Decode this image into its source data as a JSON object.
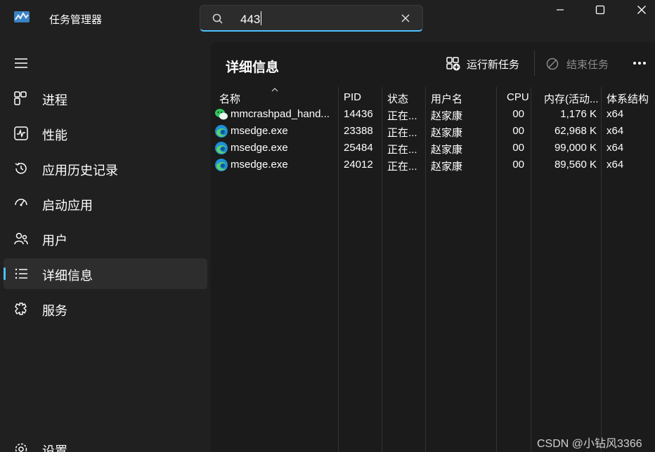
{
  "window": {
    "title": "任务管理器",
    "controls": {
      "minimize": "minimize",
      "maximize": "maximize",
      "close": "close"
    }
  },
  "search": {
    "value": "443",
    "icon": "search-icon",
    "clear_icon": "close-icon"
  },
  "sidebar": {
    "items": [
      {
        "label": "进程",
        "icon": "processes-icon"
      },
      {
        "label": "性能",
        "icon": "performance-icon"
      },
      {
        "label": "应用历史记录",
        "icon": "history-icon"
      },
      {
        "label": "启动应用",
        "icon": "startup-icon"
      },
      {
        "label": "用户",
        "icon": "users-icon"
      },
      {
        "label": "详细信息",
        "icon": "details-icon",
        "active": true
      },
      {
        "label": "服务",
        "icon": "services-icon"
      }
    ],
    "settings_label": "设置"
  },
  "main": {
    "title": "详细信息",
    "toolbar": {
      "run_task_label": "运行新任务",
      "end_task_label": "结束任务"
    }
  },
  "table": {
    "columns": [
      "名称",
      "PID",
      "状态",
      "用户名",
      "CPU",
      "内存(活动...",
      "体系结构"
    ],
    "rows": [
      {
        "name": "mmcrashpad_hand...",
        "pid": "14436",
        "status": "正在...",
        "user": "赵家康",
        "cpu": "00",
        "memory": "1,176 K",
        "arch": "x64",
        "icon": "wechat-icon"
      },
      {
        "name": "msedge.exe",
        "pid": "23388",
        "status": "正在...",
        "user": "赵家康",
        "cpu": "00",
        "memory": "62,968 K",
        "arch": "x64",
        "icon": "edge-icon"
      },
      {
        "name": "msedge.exe",
        "pid": "25484",
        "status": "正在...",
        "user": "赵家康",
        "cpu": "00",
        "memory": "99,000 K",
        "arch": "x64",
        "icon": "edge-icon"
      },
      {
        "name": "msedge.exe",
        "pid": "24012",
        "status": "正在...",
        "user": "赵家康",
        "cpu": "00",
        "memory": "89,560 K",
        "arch": "x64",
        "icon": "edge-icon"
      }
    ]
  },
  "watermark": "CSDN @小钻风3366",
  "colors": {
    "accent": "#4cc2ff",
    "background": "#202020",
    "panel": "#1b1b1b"
  }
}
